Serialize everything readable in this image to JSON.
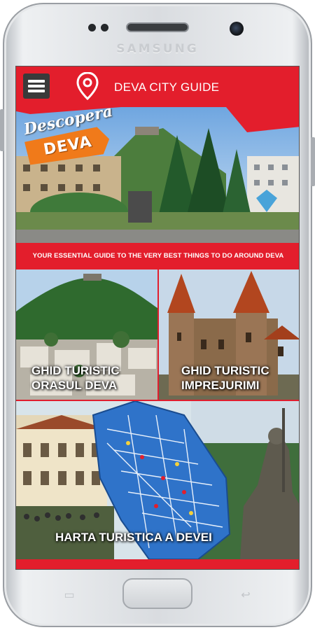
{
  "device": {
    "brand": "SAMSUNG"
  },
  "app_bar": {
    "title": "DEVA CITY GUIDE",
    "menu_icon": "hamburger-menu-icon",
    "location_icon": "location-pin-icon"
  },
  "hero": {
    "script_text": "Descopera",
    "badge_text": "DEVA",
    "tagline": "YOUR ESSENTIAL GUIDE TO THE VERY BEST THINGS TO DO AROUND DEVA"
  },
  "tiles": [
    {
      "lines": [
        "GHID TURISTIC",
        "ORASUL DEVA"
      ]
    },
    {
      "lines": [
        "GHID TURISTIC",
        "IMPREJURIMI"
      ]
    },
    {
      "lines": [
        "HARTA TURISTICA A DEVEI"
      ]
    }
  ],
  "colors": {
    "accent": "#e31e2c",
    "badge": "#f07a1a",
    "menu_button": "#3a3a3a"
  },
  "nav_keys": {
    "recent_icon": "recent-apps-icon",
    "back_icon": "back-arrow-icon"
  }
}
